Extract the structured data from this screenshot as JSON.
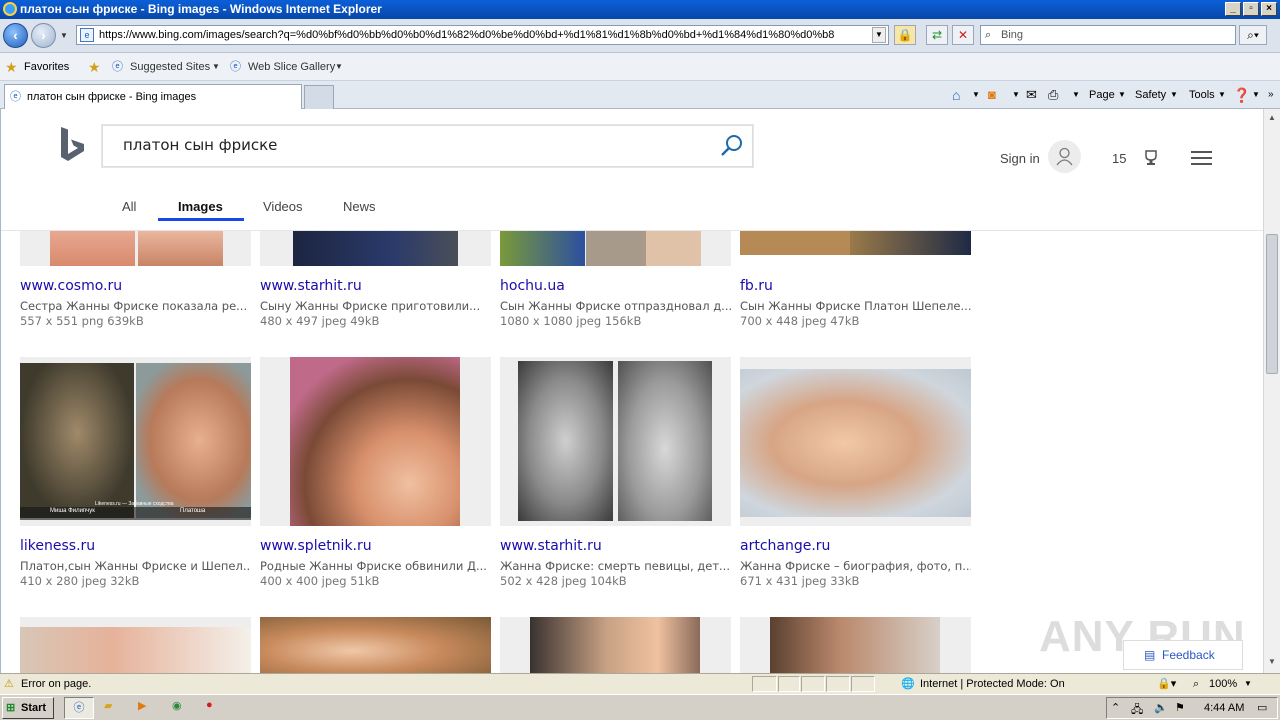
{
  "window": {
    "title": "платон сын фриске - Bing images - Windows Internet Explorer"
  },
  "navbar": {
    "address": "https://www.bing.com/images/search?q=%d0%bf%d0%bb%d0%b0%d1%82%d0%be%d0%bd+%d1%81%d1%8b%d0%bd+%d1%84%d1%80%d0%b8",
    "search_placeholder": "Bing"
  },
  "favorites": {
    "favorites_label": "Favorites",
    "suggested_label": "Suggested Sites",
    "webslice_label": "Web Slice Gallery"
  },
  "tab": {
    "title": "платон сын фриске - Bing images"
  },
  "commandbar": {
    "page": "Page",
    "safety": "Safety",
    "tools": "Tools"
  },
  "bing": {
    "query": "платон сын фриске",
    "signin": "Sign in",
    "rewards": "15",
    "scopes": [
      "All",
      "Images",
      "Videos",
      "News"
    ]
  },
  "results_row1": [
    {
      "source": "www.cosmo.ru",
      "desc": "Сестра Жанны Фриске показала ре...",
      "meta": "557 x 551 png 639kB"
    },
    {
      "source": "www.starhit.ru",
      "desc": "Сыну Жанны Фриске приготовили...",
      "meta": "480 x 497 jpeg 49kB"
    },
    {
      "source": "hochu.ua",
      "desc": "Сын Жанны Фриске отпраздновал д...",
      "meta": "1080 x 1080 jpeg 156kB"
    },
    {
      "source": "fb.ru",
      "desc": "Сын Жанны Фриске Платон Шепеле...",
      "meta": "700 x 448 jpeg 47kB"
    }
  ],
  "results_row2": [
    {
      "source": "likeness.ru",
      "desc": "Платон,сын Жанны Фриске и Шепел...",
      "meta": "410 x 280 jpeg 32kB",
      "caption_left": "Миша Филипчук",
      "caption_mid": "Likeness.ru — Забавные сходства",
      "caption_right": "Платоша"
    },
    {
      "source": "www.spletnik.ru",
      "desc": "Родные Жанны Фриске обвинили Д...",
      "meta": "400 x 400 jpeg 51kB"
    },
    {
      "source": "www.starhit.ru",
      "desc": "Жанна Фриске: смерть певицы, дет...",
      "meta": "502 x 428 jpeg 104kB"
    },
    {
      "source": "artchange.ru",
      "desc": "Жанна Фриске – биография, фото, п...",
      "meta": "671 x 431 jpeg 33kB"
    }
  ],
  "overlay": {
    "feedback": "Feedback",
    "watermark": "ANY RUN"
  },
  "status": {
    "error": "Error on page.",
    "zone": "Internet | Protected Mode: On",
    "zoom": "100%"
  },
  "taskbar": {
    "start": "Start",
    "time": "4:44 AM"
  }
}
